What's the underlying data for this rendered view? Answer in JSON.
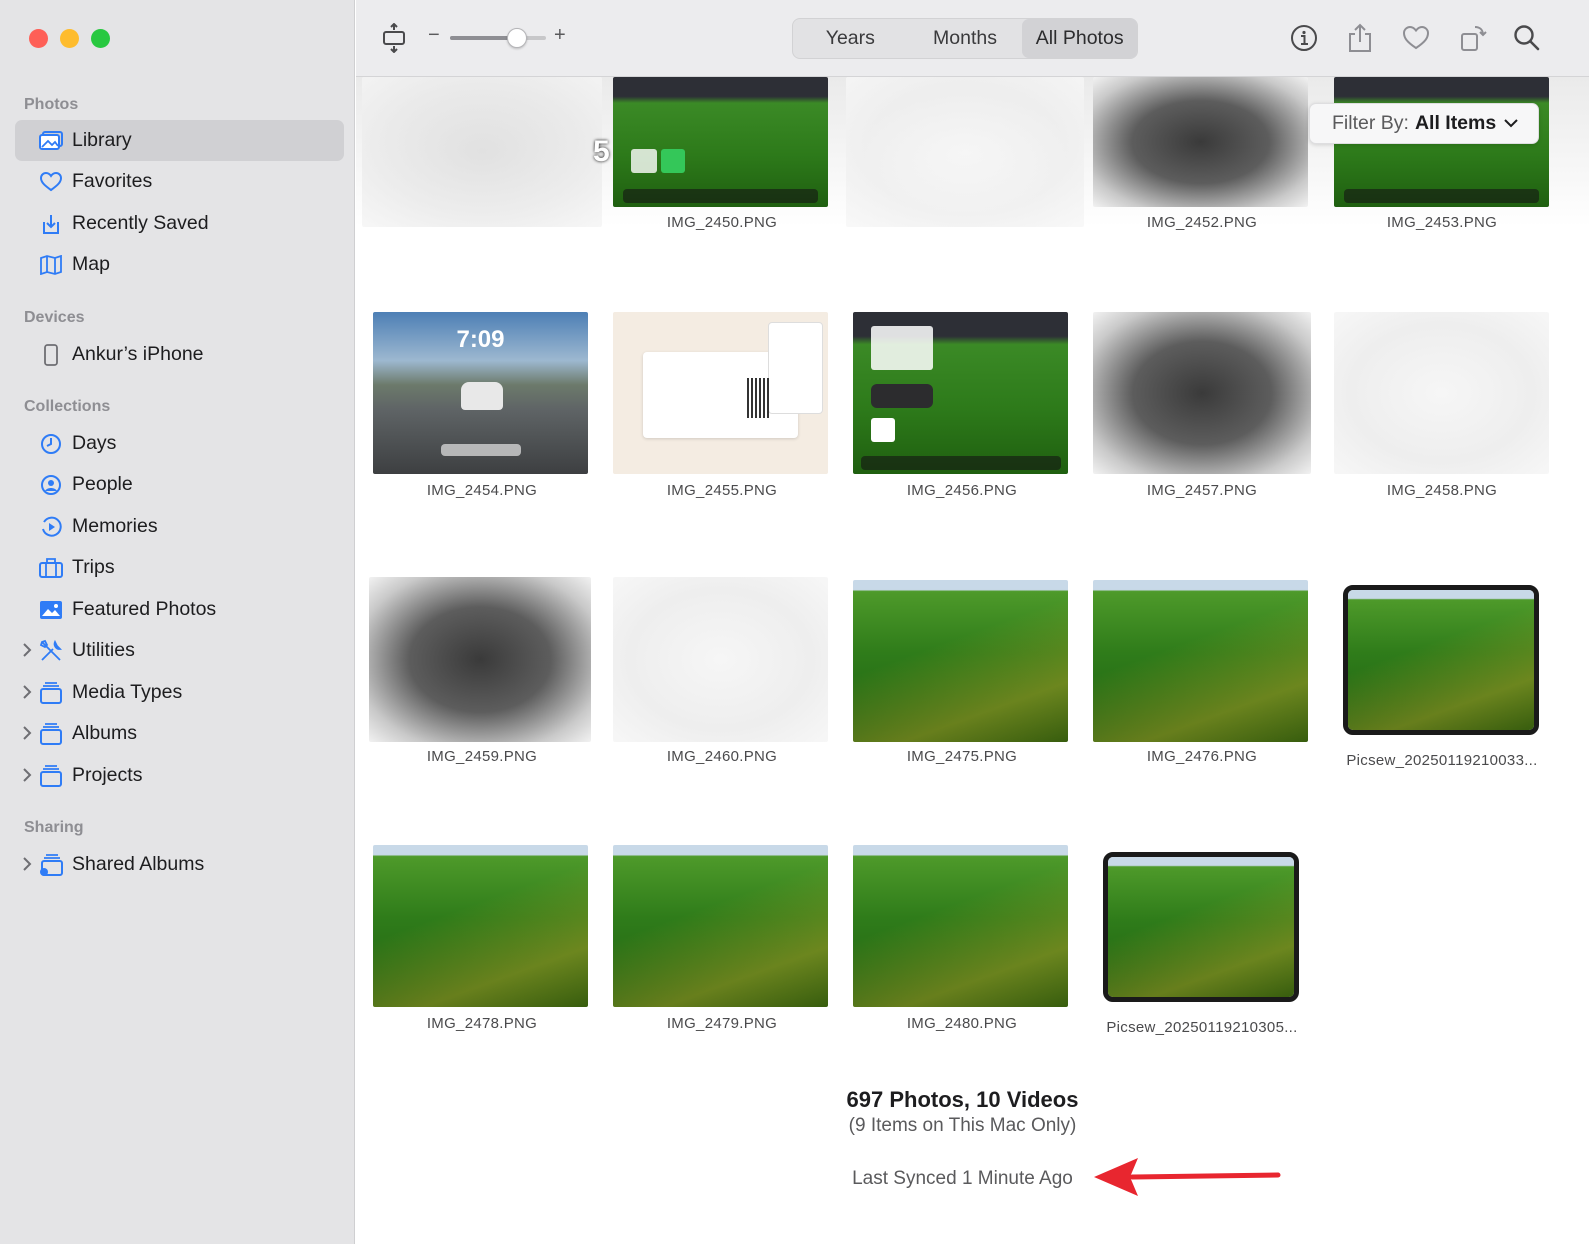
{
  "sidebar": {
    "sections": {
      "photos": "Photos",
      "devices": "Devices",
      "collections": "Collections",
      "sharing": "Sharing"
    },
    "items": {
      "library": "Library",
      "favorites": "Favorites",
      "recently_saved": "Recently Saved",
      "map": "Map",
      "iphone": "Ankur’s iPhone",
      "days": "Days",
      "people": "People",
      "memories": "Memories",
      "trips": "Trips",
      "featured": "Featured Photos",
      "utilities": "Utilities",
      "media_types": "Media Types",
      "albums": "Albums",
      "projects": "Projects",
      "shared_albums": "Shared Albums"
    }
  },
  "toolbar": {
    "zoom_minus": "−",
    "zoom_plus": "+",
    "zoom_level": 0.7,
    "tabs": {
      "years": "Years",
      "months": "Months",
      "all_photos": "All Photos"
    },
    "selected_tab": "All Photos",
    "icons": [
      "aspect-icon",
      "info-icon",
      "share-icon",
      "heart-icon",
      "rotate-icon",
      "search-icon"
    ]
  },
  "filter": {
    "label": "Filter By:",
    "value": "All Items"
  },
  "photos": {
    "row1": [
      "IMG_2450.PNG",
      "IMG_2452.PNG",
      "IMG_2453.PNG"
    ],
    "badge": "5",
    "row2": [
      "IMG_2454.PNG",
      "IMG_2455.PNG",
      "IMG_2456.PNG",
      "IMG_2457.PNG",
      "IMG_2458.PNG"
    ],
    "lock_time": "7:09",
    "row3": [
      "IMG_2459.PNG",
      "IMG_2460.PNG",
      "IMG_2475.PNG",
      "IMG_2476.PNG",
      "Picsew_20250119210033..."
    ],
    "row4": [
      "IMG_2478.PNG",
      "IMG_2479.PNG",
      "IMG_2480.PNG",
      "Picsew_20250119210305..."
    ]
  },
  "summary": {
    "count": "697 Photos, 10 Videos",
    "local": "(9 Items on This Mac Only)",
    "synced": "Last Synced 1 Minute Ago"
  },
  "colors": {
    "accent": "#2f7cf6",
    "annotation_arrow": "#e8262f"
  }
}
